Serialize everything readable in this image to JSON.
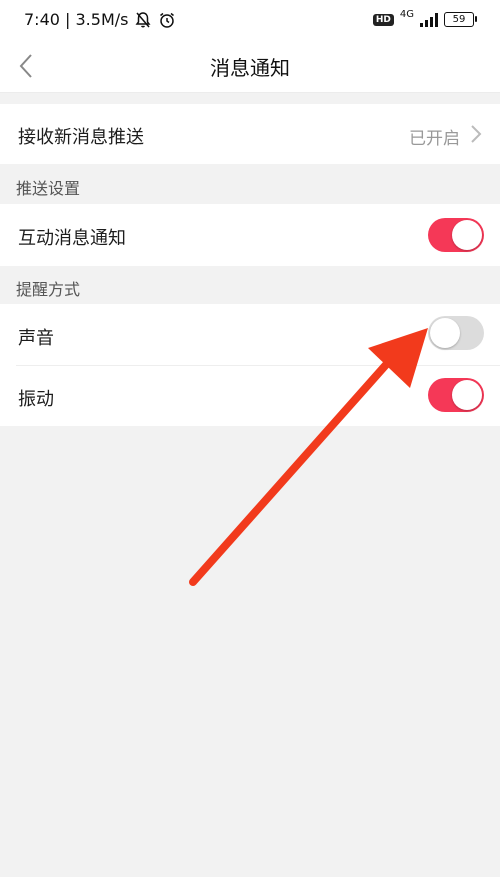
{
  "status_bar": {
    "time_speed": "7:40 | 3.5M/s",
    "hd_label": "HD",
    "network_label": "4G",
    "battery_level": "59"
  },
  "nav": {
    "title": "消息通知"
  },
  "receive_push": {
    "label": "接收新消息推送",
    "value": "已开启"
  },
  "push_settings": {
    "header": "推送设置",
    "interaction_label": "互动消息通知",
    "interaction_enabled": true
  },
  "reminder": {
    "header": "提醒方式",
    "sound_label": "声音",
    "sound_enabled": false,
    "vibrate_label": "振动",
    "vibrate_enabled": true
  },
  "colors": {
    "toggle_on": "#f53857",
    "toggle_off": "#dcdcdc",
    "annotation_arrow": "#f23a1c"
  }
}
